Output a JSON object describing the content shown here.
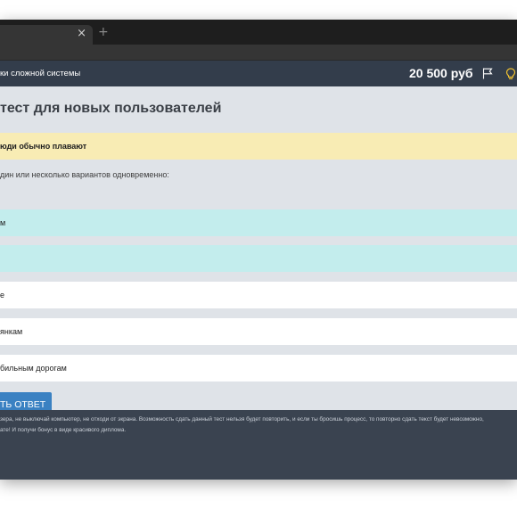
{
  "browser": {
    "tab_close": "×",
    "new_tab": "+"
  },
  "header": {
    "brand": "ки сложной системы",
    "balance": "20 500 руб",
    "icons": [
      "flag-icon",
      "lightbulb-icon"
    ],
    "bulb_color": "#f2c230"
  },
  "test": {
    "title": "тест для новых пользователей",
    "question": "юди обычно плавают",
    "instruction": "дин или несколько вариантов одновременно:",
    "options": [
      {
        "label": "м",
        "selected": true
      },
      {
        "label": "",
        "selected": true
      },
      {
        "label": "е",
        "selected": false
      },
      {
        "label": "янкам",
        "selected": false
      },
      {
        "label": "бильным дорогам",
        "selected": false
      }
    ],
    "submit_label": "ТЬ ОТВЕТ"
  },
  "footer": {
    "line1": "зера, не выключай компьютер, не отходи от экрана. Возможность сдать данный тест нельзя будет повторить, и если ты бросишь процесс, то повторно сдать текст будет невозможно,",
    "line2": "ате! И получи бонус в виде красивого диплома."
  },
  "colors": {
    "header_bg": "#333d4b",
    "question_bg": "#f8ecb4",
    "selected_option_bg": "#c3eded",
    "button_bg": "#3a81c2"
  }
}
